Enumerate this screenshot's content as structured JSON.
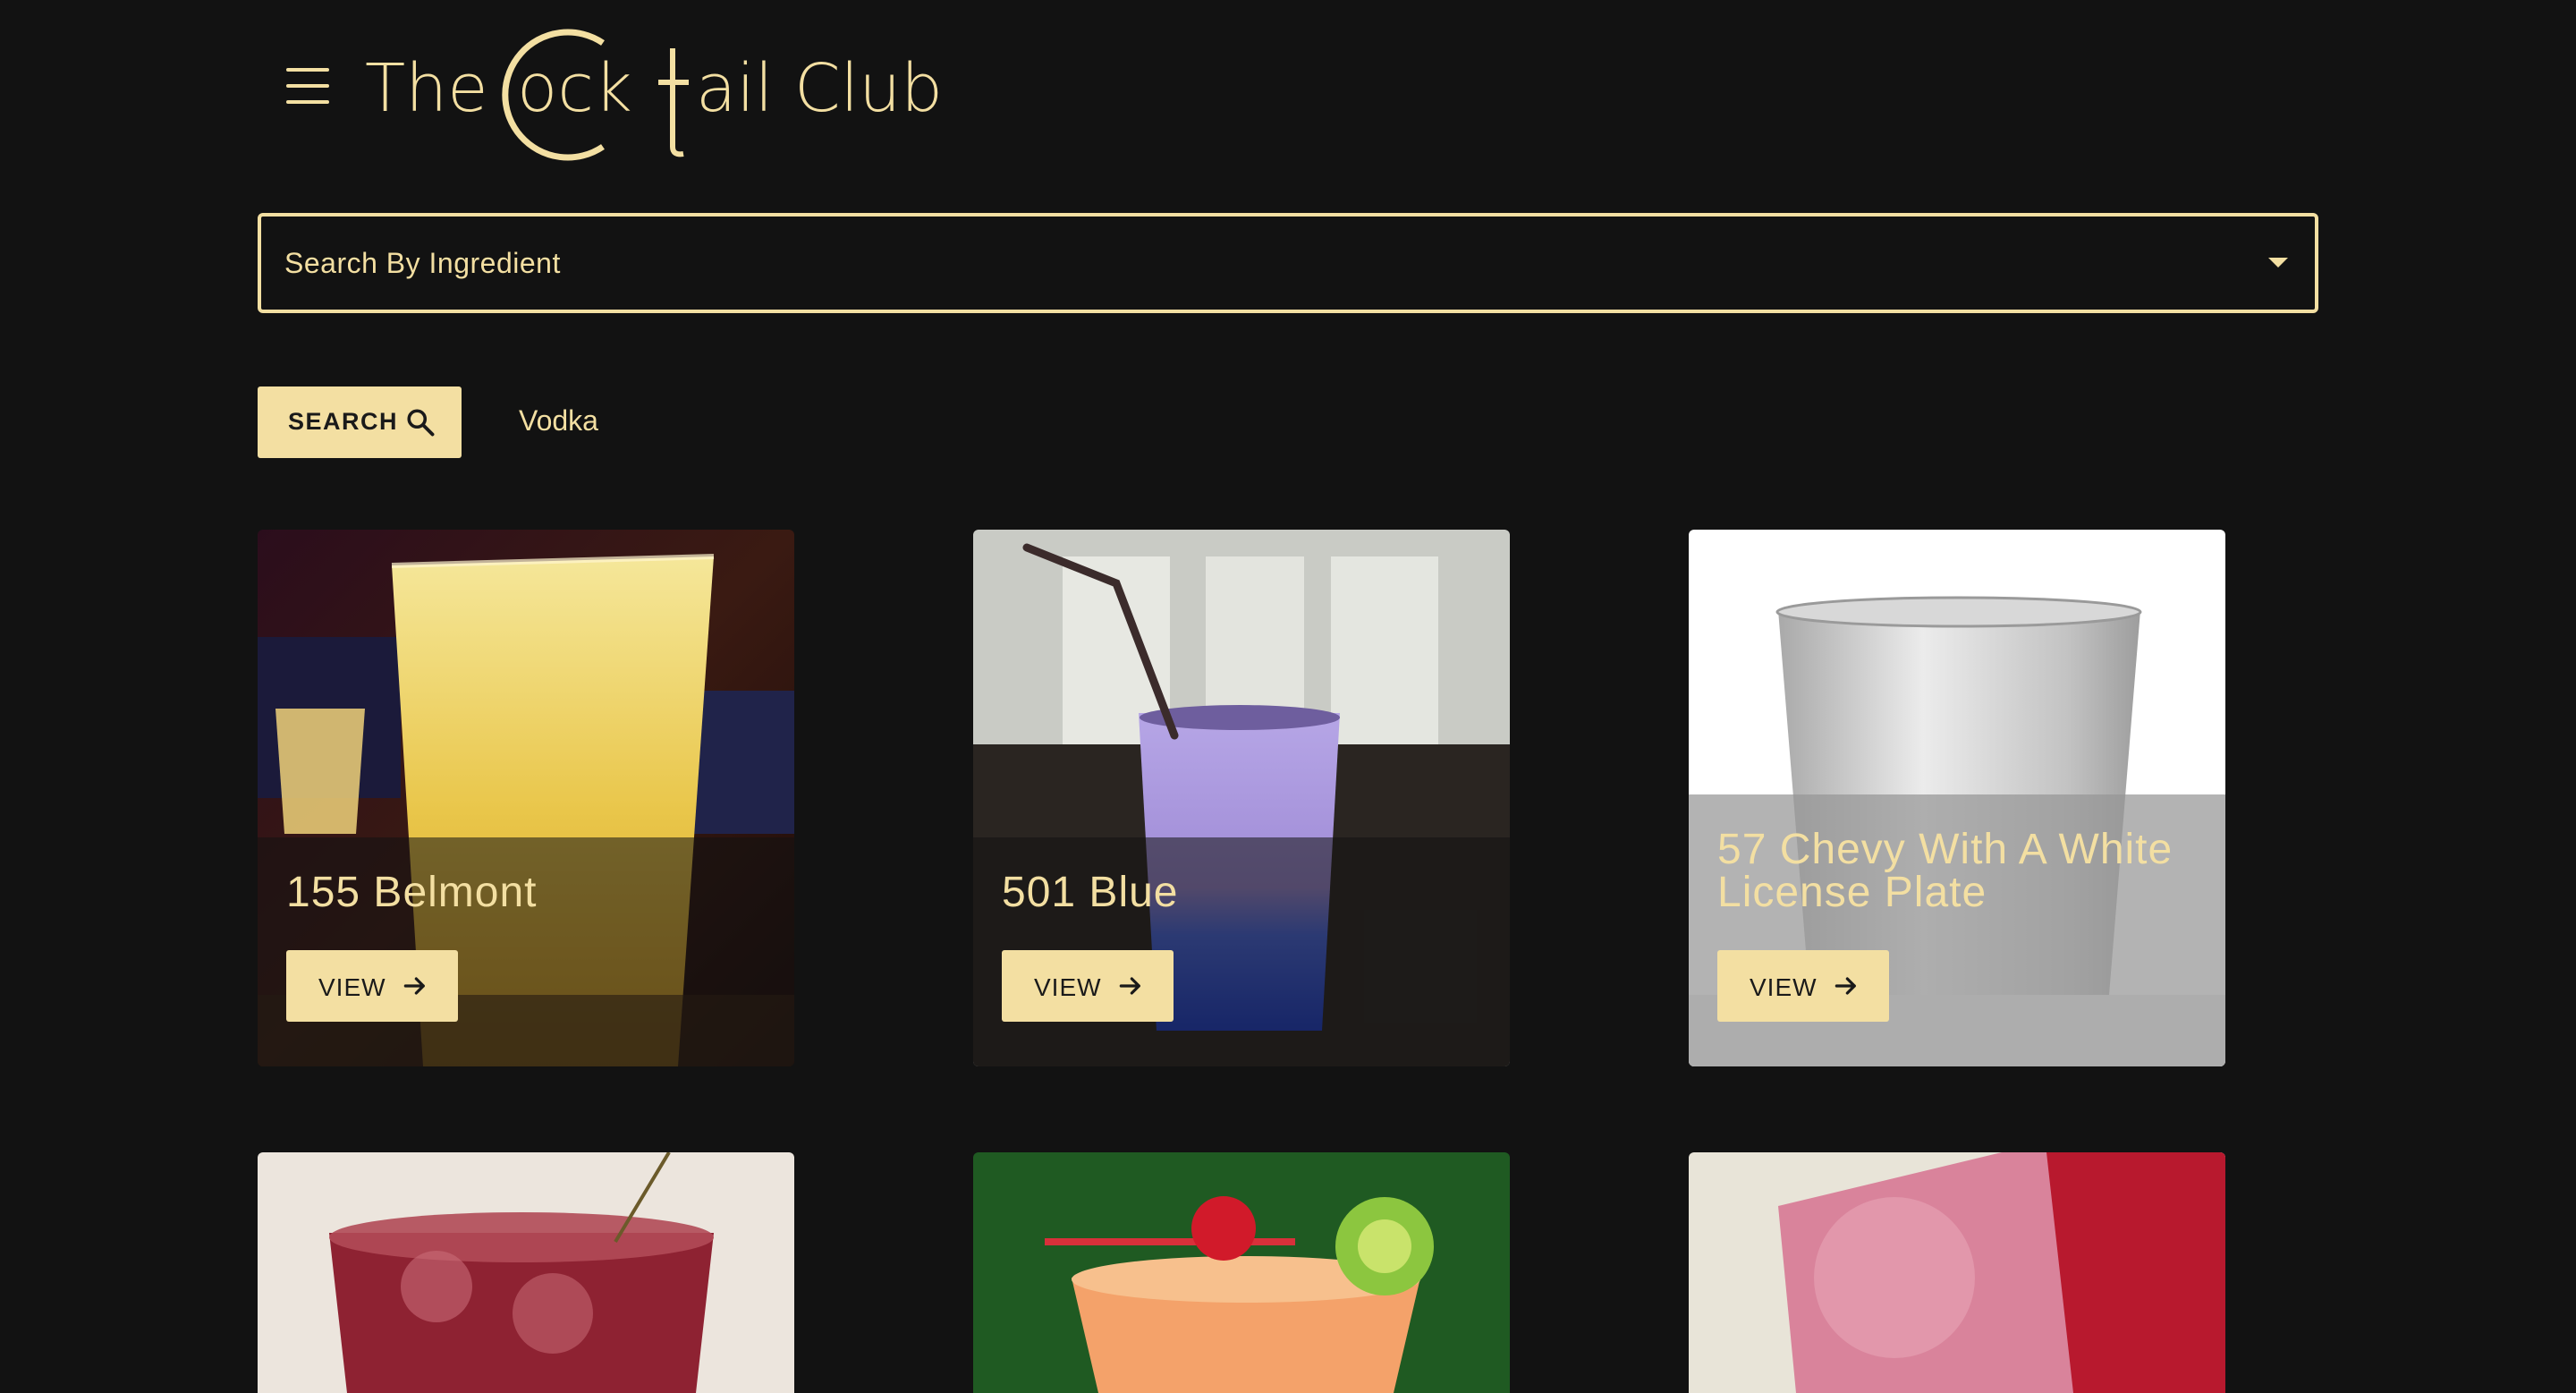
{
  "header": {
    "menu_icon": "hamburger-menu-icon",
    "logo": {
      "part1": "The",
      "part2": "ock",
      "part3": "ail Club",
      "full": "The Cocktail Club"
    }
  },
  "search": {
    "placeholder": "Search By Ingredient",
    "button_label": "SEARCH",
    "button_icon": "search-icon",
    "selected_ingredient": "Vodka"
  },
  "colors": {
    "background": "#121212",
    "accent": "#f3dfa2",
    "button_text": "#1a1a1a"
  },
  "cocktails": [
    {
      "name": "155 Belmont",
      "view_label": "VIEW",
      "view_icon": "arrow-right-icon"
    },
    {
      "name": "501 Blue",
      "view_label": "VIEW",
      "view_icon": "arrow-right-icon"
    },
    {
      "name": "57 Chevy With A White License Plate",
      "view_label": "VIEW",
      "view_icon": "arrow-right-icon"
    }
  ]
}
